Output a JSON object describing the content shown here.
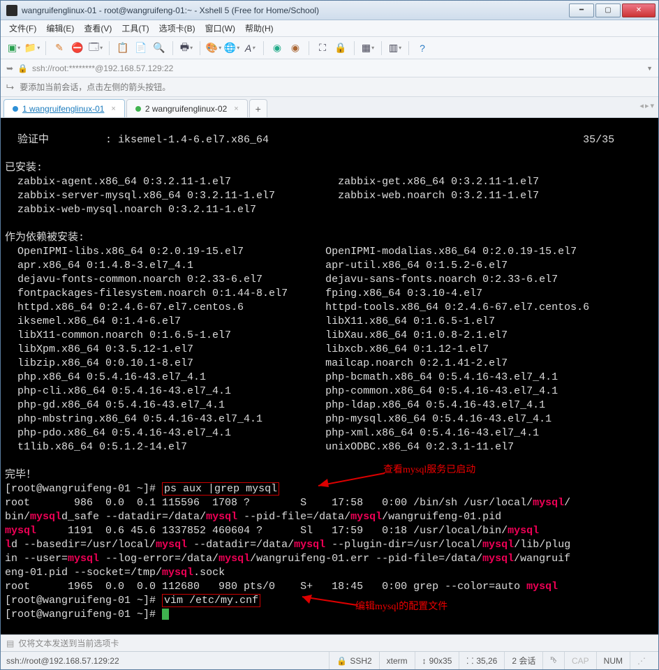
{
  "window": {
    "title": "wangruifenglinux-01 - root@wangruifeng-01:~ - Xshell 5 (Free for Home/School)"
  },
  "menu": {
    "file": "文件(F)",
    "edit": "编辑(E)",
    "view": "查看(V)",
    "tools": "工具(T)",
    "tab": "选项卡(B)",
    "window": "窗口(W)",
    "help": "帮助(H)"
  },
  "address": "ssh://root:********@192.168.57.129:22",
  "hint": "要添加当前会话，点击左侧的箭头按钮。",
  "tabs": {
    "t1": "1 wangruifenglinux-01",
    "t2": "2 wangruifenglinux-02"
  },
  "annotations": {
    "a1": "查看mysql服务已启动",
    "a2": "编辑mysql的配置文件"
  },
  "term": {
    "l01": "  验证中         : iksemel-1.4-6.el7.x86_64                                                  35/35",
    "l02": "",
    "l03": "已安装:",
    "l04": "  zabbix-agent.x86_64 0:3.2.11-1.el7                 zabbix-get.x86_64 0:3.2.11-1.el7",
    "l05": "  zabbix-server-mysql.x86_64 0:3.2.11-1.el7          zabbix-web.noarch 0:3.2.11-1.el7",
    "l06": "  zabbix-web-mysql.noarch 0:3.2.11-1.el7",
    "l07": "",
    "l08": "作为依赖被安装:",
    "l09": "  OpenIPMI-libs.x86_64 0:2.0.19-15.el7             OpenIPMI-modalias.x86_64 0:2.0.19-15.el7",
    "l10": "  apr.x86_64 0:1.4.8-3.el7_4.1                     apr-util.x86_64 0:1.5.2-6.el7",
    "l11": "  dejavu-fonts-common.noarch 0:2.33-6.el7          dejavu-sans-fonts.noarch 0:2.33-6.el7",
    "l12": "  fontpackages-filesystem.noarch 0:1.44-8.el7      fping.x86_64 0:3.10-4.el7",
    "l13": "  httpd.x86_64 0:2.4.6-67.el7.centos.6             httpd-tools.x86_64 0:2.4.6-67.el7.centos.6",
    "l14": "  iksemel.x86_64 0:1.4-6.el7                       libX11.x86_64 0:1.6.5-1.el7",
    "l15": "  libX11-common.noarch 0:1.6.5-1.el7               libXau.x86_64 0:1.0.8-2.1.el7",
    "l16": "  libXpm.x86_64 0:3.5.12-1.el7                     libxcb.x86_64 0:1.12-1.el7",
    "l17": "  libzip.x86_64 0:0.10.1-8.el7                     mailcap.noarch 0:2.1.41-2.el7",
    "l18": "  php.x86_64 0:5.4.16-43.el7_4.1                   php-bcmath.x86_64 0:5.4.16-43.el7_4.1",
    "l19": "  php-cli.x86_64 0:5.4.16-43.el7_4.1               php-common.x86_64 0:5.4.16-43.el7_4.1",
    "l20": "  php-gd.x86_64 0:5.4.16-43.el7_4.1                php-ldap.x86_64 0:5.4.16-43.el7_4.1",
    "l21": "  php-mbstring.x86_64 0:5.4.16-43.el7_4.1          php-mysql.x86_64 0:5.4.16-43.el7_4.1",
    "l22": "  php-pdo.x86_64 0:5.4.16-43.el7_4.1               php-xml.x86_64 0:5.4.16-43.el7_4.1",
    "l23": "  t1lib.x86_64 0:5.1.2-14.el7                      unixODBC.x86_64 0:2.3.1-11.el7",
    "l24": "",
    "l25": "完毕！",
    "p1a": "[root@wangruifeng-01 ~]# ",
    "p1b": "ps aux |grep mysql",
    "l27a": "root       986  0.0  0.1 115596  1708 ?        S    17:58   0:00 /bin/sh /usr/local/",
    "l27b": "mysql",
    "l27c": "/",
    "l28a": "bin/",
    "l28b": "mysql",
    "l28c": "d_safe --datadir=/data/",
    "l28d": " --pid-file=/data/",
    "l28e": "/wangruifeng-01.pid",
    "l29a": "mysql",
    "l29b": "     1191  0.6 45.6 1337852 460604 ?      Sl   17:59   0:18 /usr/local/bin/",
    "l30a": "d --basedir=/usr/local/",
    "l30b": " --datadir=/data/",
    "l30c": " --plugin-dir=/usr/local/",
    "l30d": "/lib/plug",
    "l31a": "in --user=",
    "l31b": " --log-error=/data/",
    "l31c": "/wangruifeng-01.err --pid-file=/data/",
    "l31d": "/wangruif",
    "l32a": "eng-01.pid --socket=/tmp/",
    "l32b": ".sock",
    "l33a": "root      1965  0.0  0.0 112680   980 pts/0    S+   18:45   0:00 grep --color=auto ",
    "p2a": "[root@wangruifeng-01 ~]# ",
    "p2b": "vim /etc/my.cnf",
    "p3": "[root@wangruifeng-01 ~]# "
  },
  "footer": "仅将文本发送到当前选项卡",
  "status": {
    "conn": "ssh://root@192.168.57.129:22",
    "proto": "SSH2",
    "termtype": "xterm",
    "size": "90x35",
    "pos": "35,26",
    "sessions": "2 会话",
    "cap": "CAP",
    "num": "NUM"
  }
}
